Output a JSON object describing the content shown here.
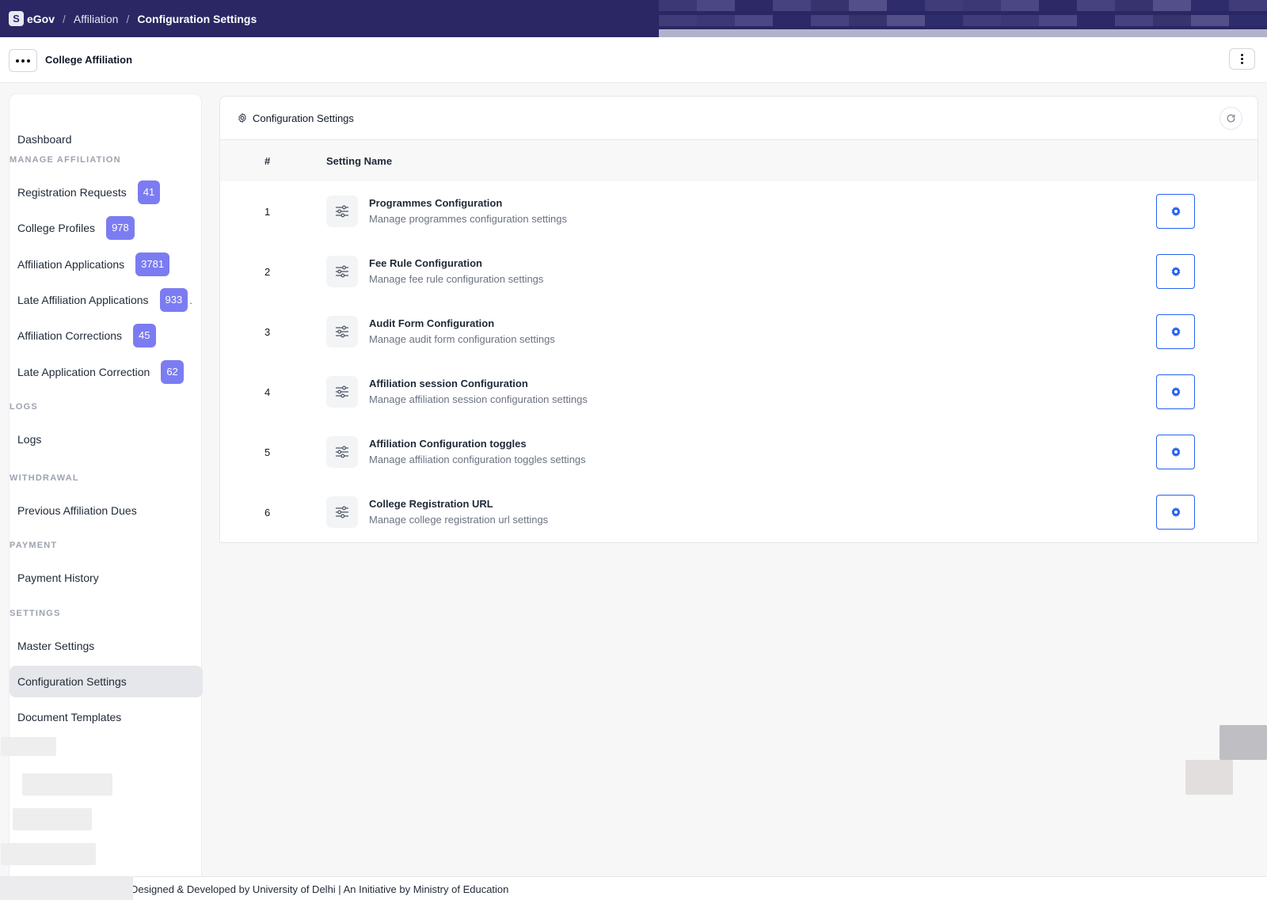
{
  "topbar": {
    "logo_letter": "S",
    "brand": "eGov",
    "breadcrumbs": [
      "Affiliation",
      "Configuration Settings"
    ],
    "separator": "/"
  },
  "subheader": {
    "title": "College Affiliation"
  },
  "sidebar": {
    "dashboard": "Dashboard",
    "sections": {
      "manage": "MANAGE AFFILIATION",
      "logs": "LOGS",
      "withdrawal": "WITHDRAWAL",
      "payment": "PAYMENT",
      "settings": "SETTINGS"
    },
    "items": [
      {
        "label": "Registration Requests",
        "badge": "41"
      },
      {
        "label": "College Profiles",
        "badge": "978"
      },
      {
        "label": "Affiliation Applications",
        "badge": "3781"
      },
      {
        "label": "Late Affiliation Applications",
        "badge": "933"
      },
      {
        "label": "Affiliation Corrections",
        "badge": "45"
      },
      {
        "label": "Late Application Correction",
        "badge": "62"
      },
      {
        "label": "Logs"
      },
      {
        "label": "Previous Affiliation Dues"
      },
      {
        "label": "Payment History"
      },
      {
        "label": "Master Settings"
      },
      {
        "label": "Configuration Settings",
        "active": true
      },
      {
        "label": "Document Templates"
      }
    ]
  },
  "card": {
    "title": "Configuration Settings",
    "columns": [
      "#",
      "Setting Name"
    ],
    "rows": [
      {
        "num": "1",
        "title": "Programmes Configuration",
        "desc": "Manage programmes configuration settings"
      },
      {
        "num": "2",
        "title": "Fee Rule Configuration",
        "desc": "Manage fee rule configuration settings"
      },
      {
        "num": "3",
        "title": "Audit Form Configuration",
        "desc": "Manage audit form configuration settings"
      },
      {
        "num": "4",
        "title": "Affiliation session Configuration",
        "desc": "Manage affiliation session configuration settings"
      },
      {
        "num": "5",
        "title": "Affiliation Configuration toggles",
        "desc": "Manage affiliation configuration toggles settings"
      },
      {
        "num": "6",
        "title": "College Registration URL",
        "desc": "Manage college registration url settings"
      }
    ]
  },
  "footer": {
    "text": "Designed & Developed by University of Delhi | An Initiative by Ministry of Education"
  },
  "colors": {
    "topbar": "#2a2764",
    "badge": "#7c7cf2",
    "action_blue": "#2563eb"
  },
  "icons": {
    "settings_row": "sliders-icon",
    "row_action": "gear-icon",
    "header": "gear-outline-icon",
    "refresh": "refresh-icon"
  }
}
